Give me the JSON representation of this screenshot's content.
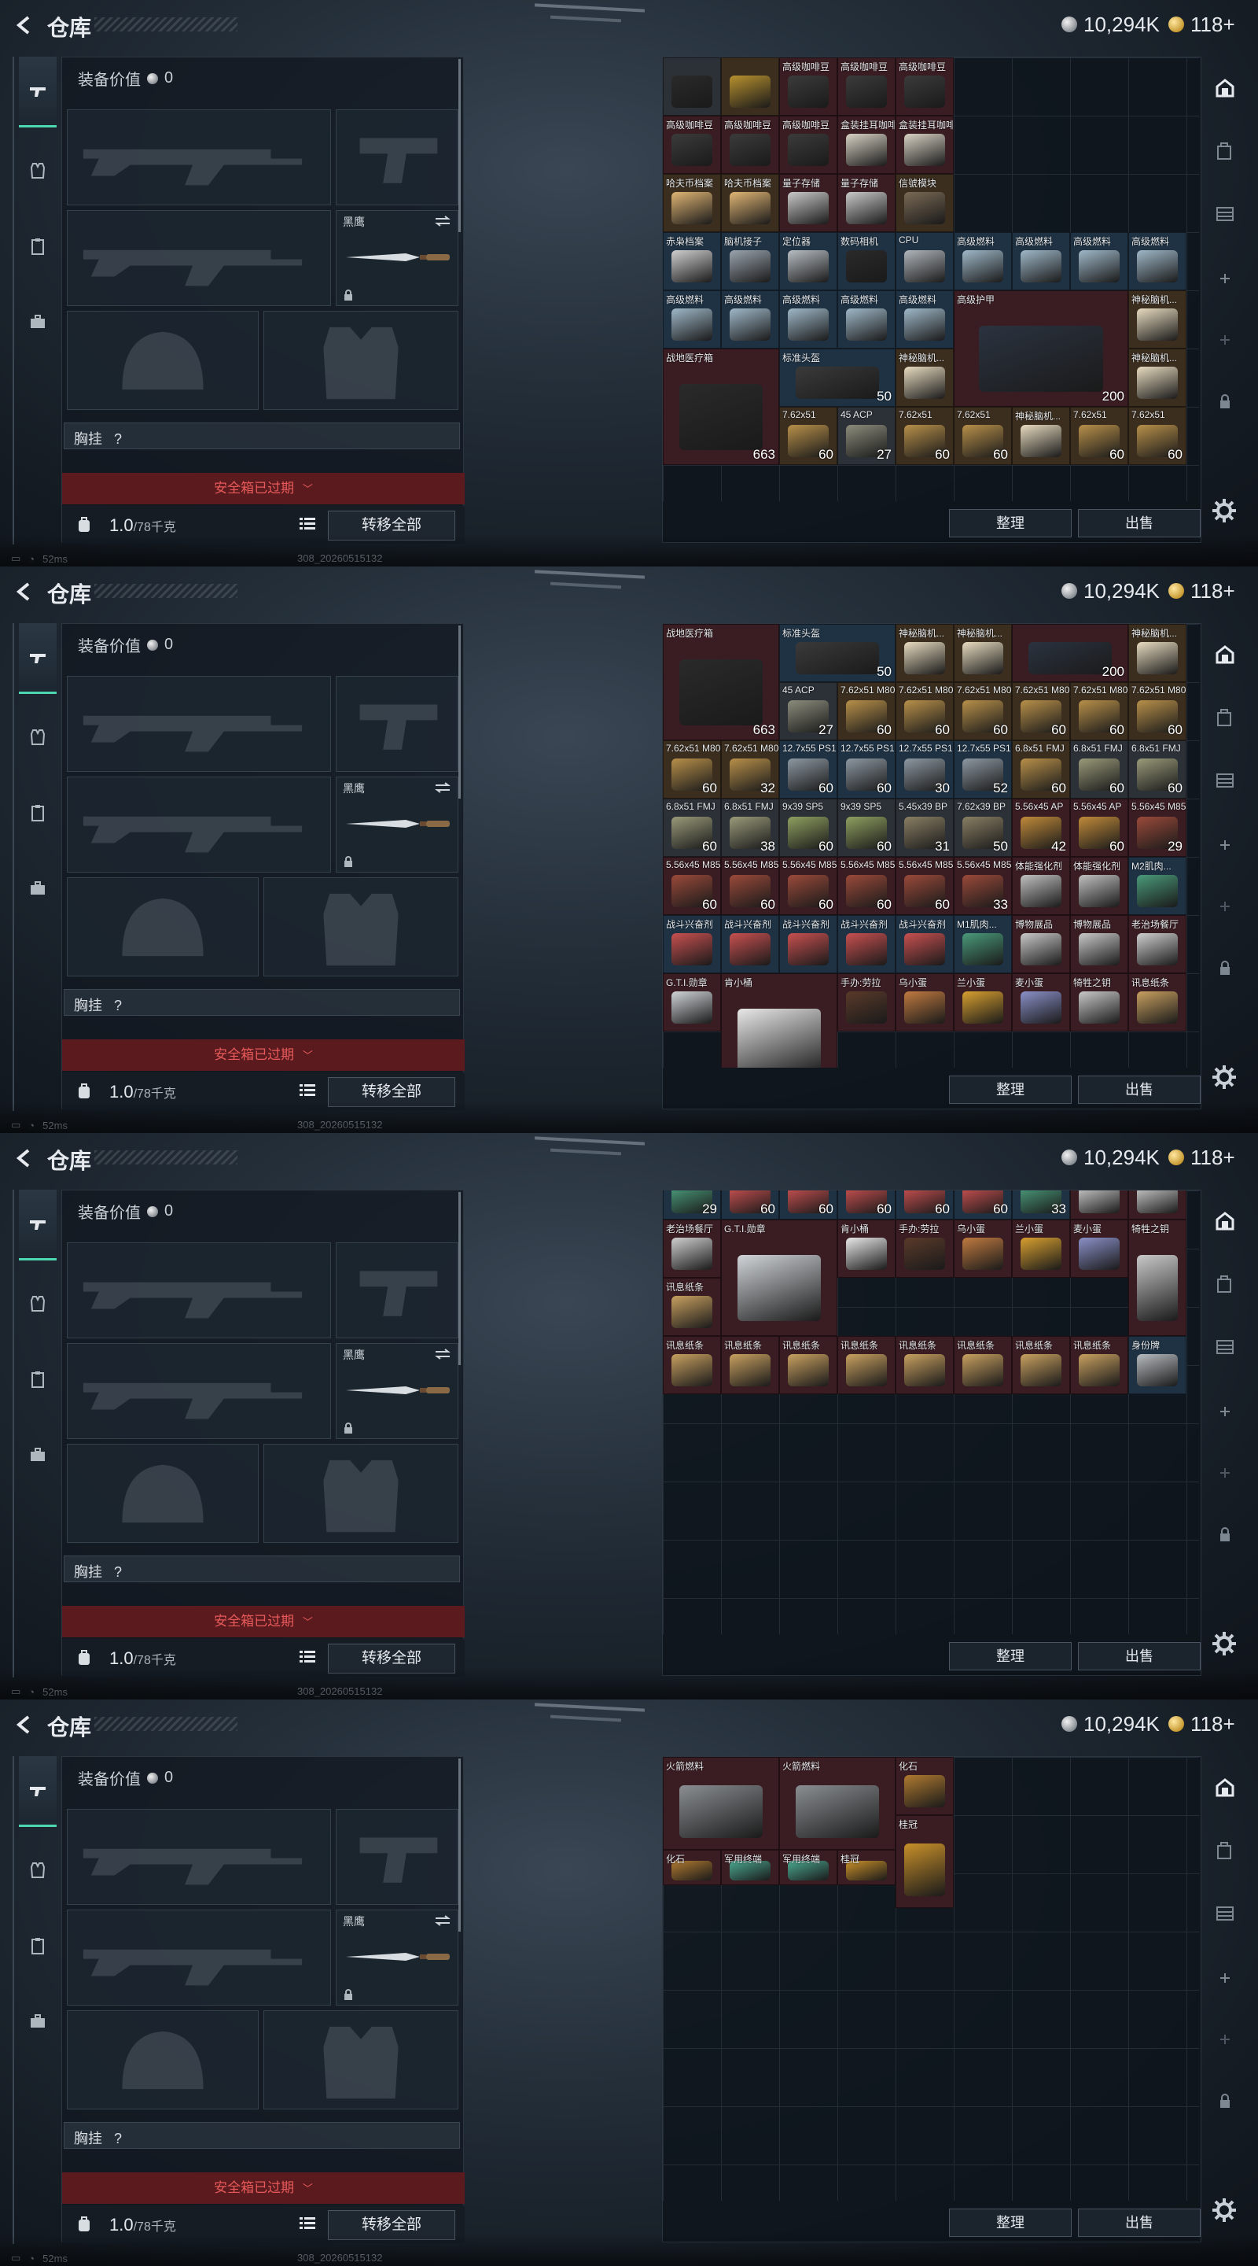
{
  "window": {
    "title": "仓库",
    "silver_amount": "10,294K",
    "gold_amount": "118+"
  },
  "status_bar": {
    "ping": "52ms",
    "version": "308_20260515132"
  },
  "equipment": {
    "value_label": "装备价值",
    "value_amount": "0",
    "knife_slot_label": "黑鹰",
    "chest_rig_label": "胸挂",
    "chest_rig_value": "?",
    "safebox_label": "安全箱已过期",
    "weight_value": "1.0",
    "weight_max": "/78千克",
    "transfer_button": "转移全部"
  },
  "storage": {
    "sort_button": "整理",
    "sell_button": "出售"
  },
  "rail_tabs": [
    "gun-icon",
    "vest-icon",
    "clipboard-icon",
    "briefcase-icon"
  ],
  "side_tabs": [
    "home-icon",
    "bag-icon",
    "grid-icon",
    "plus-icon",
    "plus-icon",
    "lock-icon"
  ],
  "panels": [
    {
      "cells": [
        {
          "name": "",
          "count": "",
          "color": "g",
          "art": "#2a2a2a"
        },
        {
          "name": "",
          "count": "",
          "color": "o",
          "art": "#b8912f"
        },
        {
          "name": "高级咖啡豆",
          "count": "",
          "color": "r",
          "art": "#3b3b3b"
        },
        {
          "name": "高级咖啡豆",
          "count": "",
          "color": "r",
          "art": "#3b3b3b"
        },
        {
          "name": "高级咖啡豆",
          "count": "",
          "color": "r",
          "art": "#3b3b3b"
        },
        {
          "name": "高级咖啡豆",
          "count": "",
          "color": "r",
          "art": "#3b3b3b"
        },
        {
          "name": "高级咖啡豆",
          "count": "",
          "color": "r",
          "art": "#3b3b3b"
        },
        {
          "name": "高级咖啡豆",
          "count": "",
          "color": "r",
          "art": "#3b3b3b"
        },
        {
          "name": "盒装挂耳咖啡",
          "count": "",
          "color": "r",
          "art": "#d8d2c4"
        },
        {
          "name": "盒装挂耳咖啡",
          "count": "",
          "color": "r",
          "art": "#d8d2c4"
        },
        {
          "name": "哈夫币档案",
          "count": "",
          "color": "o",
          "art": "#e0b574"
        },
        {
          "name": "哈夫币档案",
          "count": "",
          "color": "o",
          "art": "#e0b574"
        },
        {
          "name": "量子存储",
          "count": "",
          "color": "r",
          "art": "#c9c9c9"
        },
        {
          "name": "量子存储",
          "count": "",
          "color": "r",
          "art": "#c9c9c9"
        },
        {
          "name": "信號模块",
          "count": "",
          "color": "o",
          "art": "#7a6a55"
        },
        {
          "name": "赤枭档案",
          "count": "",
          "color": "b",
          "art": "#d0d0d0"
        },
        {
          "name": "脑机接子",
          "count": "",
          "color": "b",
          "art": "#9aa4ae"
        },
        {
          "name": "定位器",
          "count": "",
          "color": "b",
          "art": "#b8bec4"
        },
        {
          "name": "数码相机",
          "count": "",
          "color": "b",
          "art": "#2a2a2a"
        },
        {
          "name": "CPU",
          "count": "",
          "color": "b",
          "art": "#b0b6bc"
        },
        {
          "name": "高级燃料",
          "count": "",
          "color": "b",
          "art": "#9fb8c8"
        },
        {
          "name": "高级燃料",
          "count": "",
          "color": "b",
          "art": "#9fb8c8"
        },
        {
          "name": "高级燃料",
          "count": "",
          "color": "b",
          "art": "#9fb8c8"
        },
        {
          "name": "高级燃料",
          "count": "",
          "color": "b",
          "art": "#9fb8c8"
        },
        {
          "name": "高级燃料",
          "count": "",
          "color": "b",
          "art": "#9fb8c8"
        },
        {
          "name": "高级燃料",
          "count": "",
          "color": "b",
          "art": "#9fb8c8"
        },
        {
          "name": "高级燃料",
          "count": "",
          "color": "b",
          "art": "#9fb8c8"
        },
        {
          "name": "高级燃料",
          "count": "",
          "color": "b",
          "art": "#9fb8c8"
        },
        {
          "name": "高级燃料",
          "count": "",
          "color": "b",
          "art": "#9fb8c8"
        },
        {
          "name": "高级护甲",
          "count": "200",
          "color": "r",
          "art": "#2b3340"
        },
        {
          "name": "神秘脑机...",
          "count": "",
          "color": "o",
          "art": "#e8dcc0"
        },
        {
          "name": "战地医疗箱",
          "count": "663",
          "color": "r",
          "art": "#2a2a2a"
        },
        {
          "name": "标准头盔",
          "count": "50",
          "color": "b",
          "art": "#3a3a3a"
        },
        {
          "name": "神秘脑机...",
          "count": "",
          "color": "o",
          "art": "#e8dcc0"
        },
        {
          "name": "神秘脑机...",
          "count": "",
          "color": "o",
          "art": "#e8dcc0"
        },
        {
          "name": "神秘脑机...",
          "count": "",
          "color": "o",
          "art": "#e8dcc0"
        },
        {
          "name": "45 ACP",
          "count": "27",
          "color": "g",
          "art": "#8c8c7c"
        },
        {
          "name": "7.62x51",
          "count": "60",
          "color": "o",
          "art": "#b8904a"
        },
        {
          "name": "7.62x51",
          "count": "60",
          "color": "o",
          "art": "#b8904a"
        },
        {
          "name": "7.62x51",
          "count": "60",
          "color": "o",
          "art": "#b8904a"
        },
        {
          "name": "7.62x51",
          "count": "60",
          "color": "o",
          "art": "#b8904a"
        },
        {
          "name": "7.62x51",
          "count": "60",
          "color": "o",
          "art": "#b8904a"
        },
        {
          "name": "7.62x51",
          "count": "60",
          "color": "o",
          "art": "#b8904a"
        }
      ]
    },
    {
      "cells": [
        {
          "name": "战地医疗箱",
          "count": "663",
          "color": "r",
          "art": "#2a2a2a"
        },
        {
          "name": "标准头盔",
          "count": "50",
          "color": "b",
          "art": "#3a3a3a"
        },
        {
          "name": "神秘脑机...",
          "count": "",
          "color": "o",
          "art": "#e8dcc0"
        },
        {
          "name": "神秘脑机...",
          "count": "",
          "color": "o",
          "art": "#e8dcc0"
        },
        {
          "name": "",
          "count": "200",
          "color": "r",
          "art": "#2b3340"
        },
        {
          "name": "神秘脑机...",
          "count": "",
          "color": "o",
          "art": "#e8dcc0"
        },
        {
          "name": "45 ACP",
          "count": "27",
          "color": "g",
          "art": "#8c8c7c"
        },
        {
          "name": "7.62x51 M80",
          "count": "60",
          "color": "o",
          "art": "#b8904a"
        },
        {
          "name": "7.62x51 M80",
          "count": "60",
          "color": "o",
          "art": "#b8904a"
        },
        {
          "name": "7.62x51 M80",
          "count": "60",
          "color": "o",
          "art": "#b8904a"
        },
        {
          "name": "7.62x51 M80",
          "count": "60",
          "color": "o",
          "art": "#b8904a"
        },
        {
          "name": "7.62x51 M80",
          "count": "60",
          "color": "o",
          "art": "#b8904a"
        },
        {
          "name": "7.62x51 M80",
          "count": "60",
          "color": "o",
          "art": "#b8904a"
        },
        {
          "name": "7.62x51 M80",
          "count": "60",
          "color": "o",
          "art": "#b8904a"
        },
        {
          "name": "7.62x51 M80",
          "count": "32",
          "color": "o",
          "art": "#b8904a"
        },
        {
          "name": "12.7x55 PS12A",
          "count": "60",
          "color": "b",
          "art": "#8d98a2"
        },
        {
          "name": "12.7x55 PS12A",
          "count": "60",
          "color": "b",
          "art": "#8d98a2"
        },
        {
          "name": "12.7x55 PS12A",
          "count": "30",
          "color": "b",
          "art": "#8d98a2"
        },
        {
          "name": "12.7x55 PS12A",
          "count": "52",
          "color": "b",
          "art": "#8d98a2"
        },
        {
          "name": "6.8x51 FMJ",
          "count": "60",
          "color": "o",
          "art": "#b8904a"
        },
        {
          "name": "6.8x51 FMJ",
          "count": "60",
          "color": "g",
          "art": "#9a9a7a"
        },
        {
          "name": "6.8x51 FMJ",
          "count": "60",
          "color": "g",
          "art": "#9a9a7a"
        },
        {
          "name": "6.8x51 FMJ",
          "count": "60",
          "color": "g",
          "art": "#9a9a7a"
        },
        {
          "name": "6.8x51 FMJ",
          "count": "38",
          "color": "g",
          "art": "#9a9a7a"
        },
        {
          "name": "9x39 SP5",
          "count": "60",
          "color": "g",
          "art": "#8fa060"
        },
        {
          "name": "9x39 SP5",
          "count": "60",
          "color": "g",
          "art": "#8fa060"
        },
        {
          "name": "5.45x39 BP",
          "count": "31",
          "color": "g",
          "art": "#8a7f64"
        },
        {
          "name": "7.62x39 BP",
          "count": "50",
          "color": "g",
          "art": "#8a7f64"
        },
        {
          "name": "5.56x45 AP",
          "count": "42",
          "color": "r",
          "art": "#c08a3a"
        },
        {
          "name": "5.56x45 AP",
          "count": "60",
          "color": "r",
          "art": "#c08a3a"
        },
        {
          "name": "5.56x45 M855A1",
          "count": "29",
          "color": "r",
          "art": "#9a4a3a"
        },
        {
          "name": "5.56x45 M855A1",
          "count": "60",
          "color": "r",
          "art": "#9a4a3a"
        },
        {
          "name": "5.56x45 M855A1",
          "count": "60",
          "color": "r",
          "art": "#9a4a3a"
        },
        {
          "name": "5.56x45 M855A1",
          "count": "60",
          "color": "r",
          "art": "#9a4a3a"
        },
        {
          "name": "5.56x45 M855A1",
          "count": "60",
          "color": "r",
          "art": "#9a4a3a"
        },
        {
          "name": "5.56x45 M855A1",
          "count": "60",
          "color": "r",
          "art": "#9a4a3a"
        },
        {
          "name": "5.56x45 M855A1",
          "count": "33",
          "color": "r",
          "art": "#9a4a3a"
        },
        {
          "name": "体能强化剂",
          "count": "",
          "color": "r",
          "art": "#c0c0c0"
        },
        {
          "name": "体能强化剂",
          "count": "",
          "color": "r",
          "art": "#c0c0c0"
        },
        {
          "name": "M2肌肉...",
          "count": "",
          "color": "b",
          "art": "#4a9a7a"
        },
        {
          "name": "战斗兴奋剂",
          "count": "",
          "color": "b",
          "art": "#c85050"
        },
        {
          "name": "战斗兴奋剂",
          "count": "",
          "color": "b",
          "art": "#c85050"
        },
        {
          "name": "战斗兴奋剂",
          "count": "",
          "color": "b",
          "art": "#c85050"
        },
        {
          "name": "战斗兴奋剂",
          "count": "",
          "color": "b",
          "art": "#c85050"
        },
        {
          "name": "战斗兴奋剂",
          "count": "",
          "color": "b",
          "art": "#c85050"
        },
        {
          "name": "M1肌肉...",
          "count": "",
          "color": "b",
          "art": "#4a9a7a"
        },
        {
          "name": "博物展品",
          "count": "",
          "color": "r",
          "art": "#c8c8c8"
        },
        {
          "name": "博物展品",
          "count": "",
          "color": "r",
          "art": "#c8c8c8"
        },
        {
          "name": "老治场餐厅",
          "count": "",
          "color": "r",
          "art": "#cfcfcf"
        },
        {
          "name": "G.T.I.勋章",
          "count": "",
          "color": "r",
          "art": "#d0d4d8"
        },
        {
          "name": "肯小桶",
          "count": "",
          "color": "r",
          "art": "#e8e8e8"
        },
        {
          "name": "手办:劳拉",
          "count": "",
          "color": "r",
          "art": "#5a3a2a"
        },
        {
          "name": "乌小蛋",
          "count": "",
          "color": "r",
          "art": "#c07a40"
        },
        {
          "name": "兰小蛋",
          "count": "",
          "color": "r",
          "art": "#d8a030"
        },
        {
          "name": "麦小蛋",
          "count": "",
          "color": "r",
          "art": "#8a90c8"
        },
        {
          "name": "犄牲之钥",
          "count": "",
          "color": "r",
          "art": "#c8c8c8"
        },
        {
          "name": "讯息纸条",
          "count": "",
          "color": "r",
          "art": "#c8a060"
        }
      ]
    },
    {
      "cells": [
        {
          "name": "M2肌肉...",
          "count": "29",
          "color": "b",
          "art": "#4a9a7a"
        },
        {
          "name": "战斗兴奋剂",
          "count": "60",
          "color": "b",
          "art": "#c85050"
        },
        {
          "name": "战斗兴奋剂",
          "count": "60",
          "color": "b",
          "art": "#c85050"
        },
        {
          "name": "战斗兴奋剂",
          "count": "60",
          "color": "b",
          "art": "#c85050"
        },
        {
          "name": "战斗兴奋剂",
          "count": "60",
          "color": "b",
          "art": "#c85050"
        },
        {
          "name": "战斗兴奋剂",
          "count": "60",
          "color": "b",
          "art": "#c85050"
        },
        {
          "name": "M1肌肉...",
          "count": "33",
          "color": "b",
          "art": "#4a9a7a"
        },
        {
          "name": "博物展品",
          "count": "",
          "color": "r",
          "art": "#c8c8c8"
        },
        {
          "name": "博物展品",
          "count": "",
          "color": "r",
          "art": "#c8c8c8"
        },
        {
          "name": "老治场餐厅",
          "count": "",
          "color": "r",
          "art": "#cfcfcf"
        },
        {
          "name": "G.T.I.勋章",
          "count": "",
          "color": "r",
          "art": "#d0d4d8"
        },
        {
          "name": "肯小桶",
          "count": "",
          "color": "r",
          "art": "#e8e8e8"
        },
        {
          "name": "手办:劳拉",
          "count": "",
          "color": "r",
          "art": "#5a3a2a"
        },
        {
          "name": "乌小蛋",
          "count": "",
          "color": "r",
          "art": "#c07a40"
        },
        {
          "name": "兰小蛋",
          "count": "",
          "color": "r",
          "art": "#d8a030"
        },
        {
          "name": "麦小蛋",
          "count": "",
          "color": "r",
          "art": "#8a90c8"
        },
        {
          "name": "犄牲之钥",
          "count": "",
          "color": "r",
          "art": "#c8c8c8"
        },
        {
          "name": "讯息纸条",
          "count": "",
          "color": "r",
          "art": "#c8a060"
        },
        {
          "name": "讯息纸条",
          "count": "",
          "color": "r",
          "art": "#c8a060"
        },
        {
          "name": "讯息纸条",
          "count": "",
          "color": "r",
          "art": "#c8a060"
        },
        {
          "name": "讯息纸条",
          "count": "",
          "color": "r",
          "art": "#c8a060"
        },
        {
          "name": "讯息纸条",
          "count": "",
          "color": "r",
          "art": "#c8a060"
        },
        {
          "name": "讯息纸条",
          "count": "",
          "color": "r",
          "art": "#c8a060"
        },
        {
          "name": "讯息纸条",
          "count": "",
          "color": "r",
          "art": "#c8a060"
        },
        {
          "name": "讯息纸条",
          "count": "",
          "color": "r",
          "art": "#c8a060"
        },
        {
          "name": "讯息纸条",
          "count": "",
          "color": "r",
          "art": "#c8a060"
        },
        {
          "name": "身份牌",
          "count": "",
          "color": "b",
          "art": "#b8bcc0"
        }
      ]
    },
    {
      "cells": [
        {
          "name": "火箭燃料",
          "count": "",
          "color": "r",
          "art": "#8a8e92"
        },
        {
          "name": "火箭燃料",
          "count": "",
          "color": "r",
          "art": "#8a8e92"
        },
        {
          "name": "化石",
          "count": "",
          "color": "r",
          "art": "#b07a30"
        },
        {
          "name": "桂冠",
          "count": "",
          "color": "r",
          "art": "#c8902a"
        },
        {
          "name": "化石",
          "count": "",
          "color": "r",
          "art": "#b07a30"
        },
        {
          "name": "军用终端",
          "count": "",
          "color": "r",
          "art": "#4aa890"
        },
        {
          "name": "军用终端",
          "count": "",
          "color": "r",
          "art": "#4aa890"
        },
        {
          "name": "桂冠",
          "count": "",
          "color": "r",
          "art": "#c8902a"
        }
      ]
    }
  ]
}
